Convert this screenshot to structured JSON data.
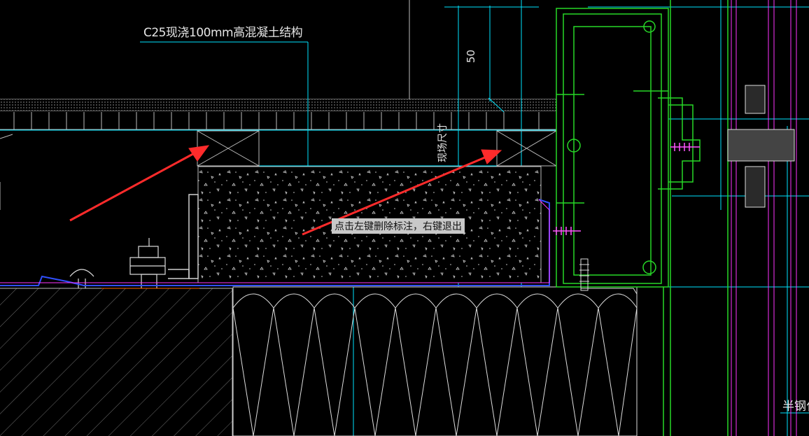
{
  "drawing": {
    "top_label": "C25现浇100mm高混凝土结构",
    "dimension_50": "50",
    "site_size_label": "现场尺寸",
    "tooltip": "点击左键删除标注，右键退出",
    "bottom_right_label": "半钢化"
  },
  "colors": {
    "background": "#000000",
    "cyan": "#00e5ff",
    "green": "#27d827",
    "white": "#ffffff",
    "magenta": "#ff33ff",
    "red": "#ff2b2b",
    "blue": "#3050ff",
    "gray": "#9a9a9a"
  }
}
